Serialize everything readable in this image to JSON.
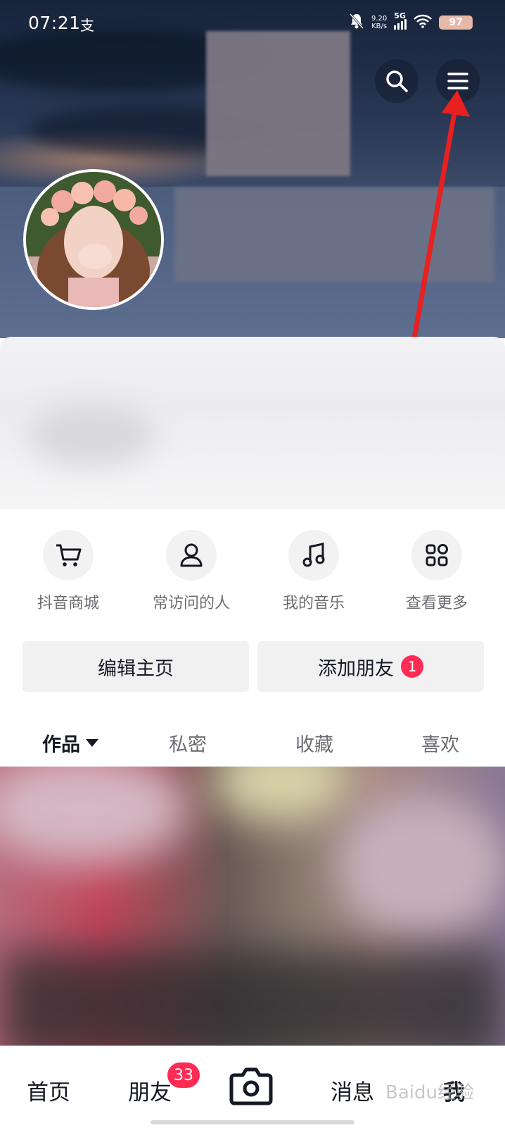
{
  "status_bar": {
    "time": "07:21",
    "app_glyph": "支",
    "net_speed_value": "9.20",
    "net_speed_unit": "KB/s",
    "network": "5G",
    "battery": "97",
    "icons": [
      "mute-bell-icon",
      "signal-icon",
      "wifi-icon",
      "battery-icon"
    ]
  },
  "header": {
    "search_icon": "search-icon",
    "menu_icon": "menu-icon",
    "annotation_color": "#e8201f"
  },
  "quick_entries": [
    {
      "label": "抖音商城",
      "icon": "cart-icon"
    },
    {
      "label": "常访问的人",
      "icon": "person-icon"
    },
    {
      "label": "我的音乐",
      "icon": "music-note-icon"
    },
    {
      "label": "查看更多",
      "icon": "grid-more-icon"
    }
  ],
  "actions": {
    "edit_profile": "编辑主页",
    "add_friend": "添加朋友",
    "add_friend_badge": "1"
  },
  "tabs": [
    {
      "label": "作品",
      "active": true
    },
    {
      "label": "私密"
    },
    {
      "label": "收藏"
    },
    {
      "label": "喜欢"
    }
  ],
  "bottom_nav": {
    "home": "首页",
    "friends": "朋友",
    "friends_badge": "33",
    "camera_icon": "camera-icon",
    "messages": "消息",
    "me": "我"
  },
  "watermark": "Baidu经验",
  "colors": {
    "accent": "#fe2c55",
    "text_primary": "#161823",
    "text_secondary": "#6b6c72"
  }
}
